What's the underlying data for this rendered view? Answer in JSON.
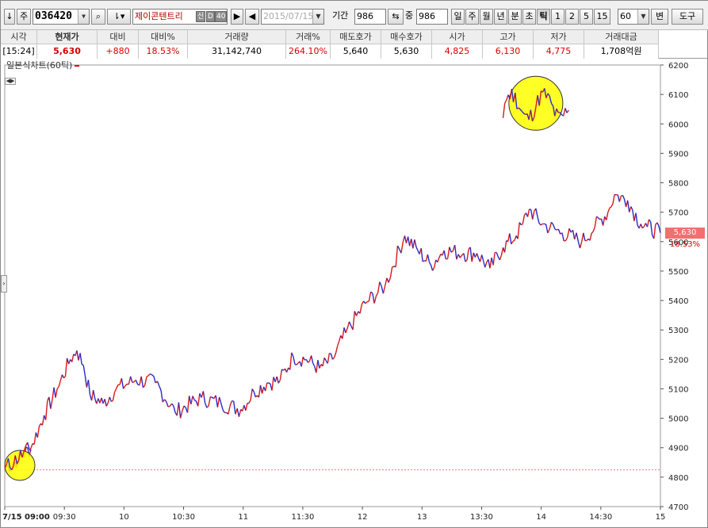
{
  "toolbar": {
    "arrow_btn": "↓",
    "market_btn": "주",
    "code": "036420",
    "name": "제이콘텐트리",
    "tag_credit": "신",
    "tag_ratio": "D",
    "tag_margin": "40",
    "date": "2015/07/15",
    "period_label": "기간",
    "period_value": "986",
    "overlap_label": "중",
    "overlap_value": "986",
    "timeframes": [
      "일",
      "주",
      "월",
      "년",
      "분",
      "초",
      "틱",
      "1",
      "2",
      "5",
      "15"
    ],
    "active_timeframe": "틱",
    "tick_value": "60",
    "overflow_btn": "변",
    "tools_btn": "도구"
  },
  "quote": {
    "headers": [
      "시각",
      "현재가",
      "대비",
      "대비%",
      "거래량",
      "거래%",
      "매도호가",
      "매수호가",
      "시가",
      "고가",
      "저가",
      "거래대금"
    ],
    "values": [
      "[15:24]",
      "5,630",
      "+880",
      "18.53%",
      "31,142,740",
      "264.10%",
      "5,640",
      "5,630",
      "4,825",
      "6,130",
      "4,775",
      "1,708억원"
    ]
  },
  "chart_data": {
    "type": "line",
    "title": "일본식차트(60틱)",
    "x_tick_labels": [
      "7/15 09:00",
      "09:30",
      "10",
      "10:30",
      "11",
      "11:30",
      "12",
      "13",
      "13:30",
      "14",
      "14:30",
      "15"
    ],
    "y_tick_labels": [
      "4700",
      "4800",
      "4900",
      "5000",
      "5100",
      "5200",
      "5300",
      "5400",
      "5500",
      "5600",
      "5700",
      "5800",
      "5900",
      "6000",
      "6100",
      "6200"
    ],
    "ylim": [
      4700,
      6200
    ],
    "reference_line": 4825,
    "last_price": "5,630",
    "last_change_pct": "18.53%",
    "series": [
      {
        "x": [
          0,
          0.02,
          0.04,
          0.06,
          0.08,
          0.1,
          0.11,
          0.12,
          0.13,
          0.15,
          0.17,
          0.2,
          0.23,
          0.26,
          0.3,
          0.33,
          0.36,
          0.38,
          0.4,
          0.42,
          0.44,
          0.46,
          0.48,
          0.5,
          0.52,
          0.55,
          0.58,
          0.61,
          0.63,
          0.65,
          0.67,
          0.7,
          0.72,
          0.74,
          0.76,
          0.78,
          0.79,
          0.8,
          0.82,
          0.85,
          0.88,
          0.9,
          0.92,
          0.93,
          0.95,
          0.97,
          0.98,
          1.0
        ],
        "y": [
          4830,
          4860,
          4900,
          5010,
          5100,
          5200,
          5230,
          5180,
          5080,
          5050,
          5100,
          5130,
          5120,
          5020,
          5070,
          5050,
          5030,
          5090,
          5120,
          5130,
          5210,
          5200,
          5170,
          5200,
          5290,
          5390,
          5450,
          5620,
          5570,
          5520,
          5570,
          5560,
          5560,
          5510,
          5580,
          5620,
          5660,
          5710,
          5660,
          5630,
          5600,
          5650,
          5700,
          5760,
          5740,
          5660,
          5650,
          5630
        ]
      }
    ]
  }
}
